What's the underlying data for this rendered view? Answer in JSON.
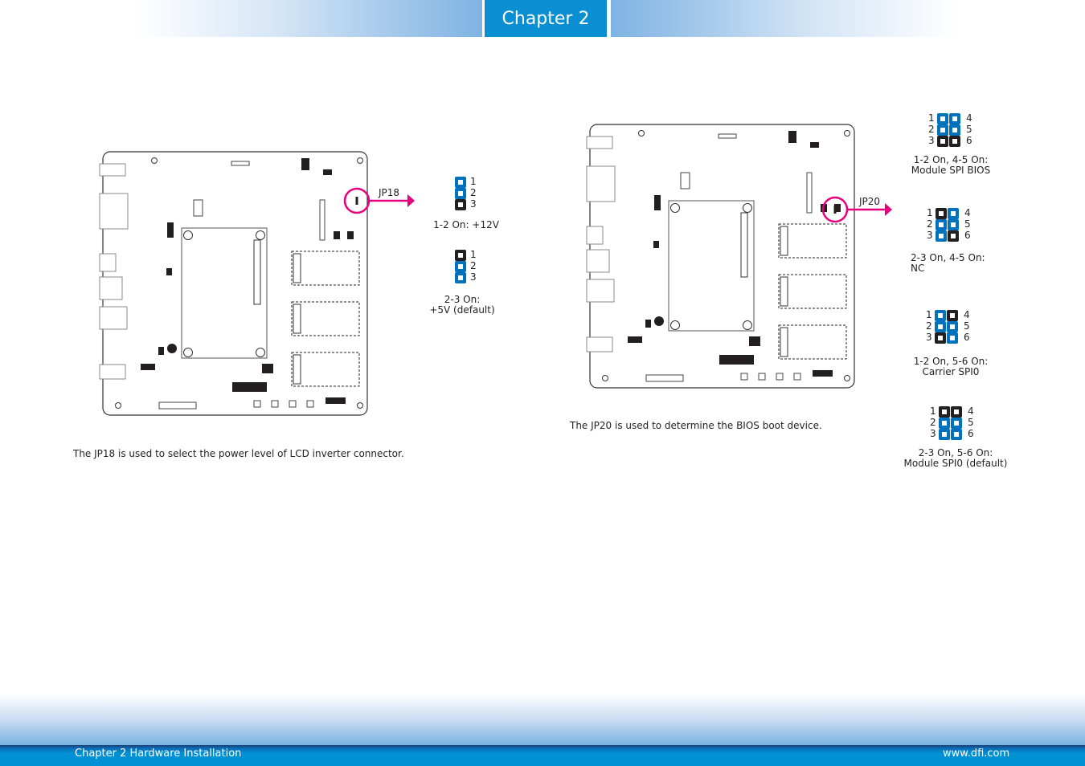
{
  "header": {
    "chapter": "Chapter 2"
  },
  "left": {
    "callout_label": "JP18",
    "description": "The JP18 is used to select the power level of LCD inverter connector.",
    "jumpers": [
      {
        "pins": [
          "on",
          "on",
          "off"
        ],
        "numbers": [
          "1",
          "2",
          "3"
        ],
        "caption": [
          "1-2 On: +12V"
        ]
      },
      {
        "pins": [
          "off",
          "on",
          "on"
        ],
        "numbers": [
          "1",
          "2",
          "3"
        ],
        "caption": [
          "2-3 On:",
          "+5V (default)"
        ]
      }
    ]
  },
  "right": {
    "callout_label": "JP20",
    "description": "The JP20 is used to determine the BIOS boot device.",
    "jumpers": [
      {
        "left": [
          "on",
          "on",
          "off"
        ],
        "right": [
          "on",
          "on",
          "off"
        ],
        "left_numbers": [
          "1",
          "2",
          "3"
        ],
        "right_numbers": [
          "4",
          "5",
          "6"
        ],
        "caption": [
          "1-2 On, 4-5 On:",
          "Module SPI BIOS"
        ]
      },
      {
        "left": [
          "off",
          "on",
          "on"
        ],
        "right": [
          "on",
          "on",
          "off"
        ],
        "left_numbers": [
          "1",
          "2",
          "3"
        ],
        "right_numbers": [
          "4",
          "5",
          "6"
        ],
        "caption": [
          "2-3 On, 4-5 On:",
          "NC"
        ]
      },
      {
        "left": [
          "on",
          "on",
          "off"
        ],
        "right": [
          "off",
          "on",
          "on"
        ],
        "left_numbers": [
          "1",
          "2",
          "3"
        ],
        "right_numbers": [
          "4",
          "5",
          "6"
        ],
        "caption": [
          "1-2 On, 5-6 On:",
          "Carrier SPI0"
        ]
      },
      {
        "left": [
          "off",
          "on",
          "on"
        ],
        "right": [
          "off",
          "on",
          "on"
        ],
        "left_numbers": [
          "1",
          "2",
          "3"
        ],
        "right_numbers": [
          "4",
          "5",
          "6"
        ],
        "caption": [
          "2-3 On, 5-6 On:",
          "Module SPI0 (default)"
        ]
      }
    ]
  },
  "footer": {
    "left": "Chapter 2 Hardware Installation",
    "right": "www.dfi.com"
  },
  "colors": {
    "brand_blue": "#0a8fd3",
    "jumper_on": "#0071bc",
    "jumper_off": "#231f20",
    "callout": "#e6007e"
  }
}
